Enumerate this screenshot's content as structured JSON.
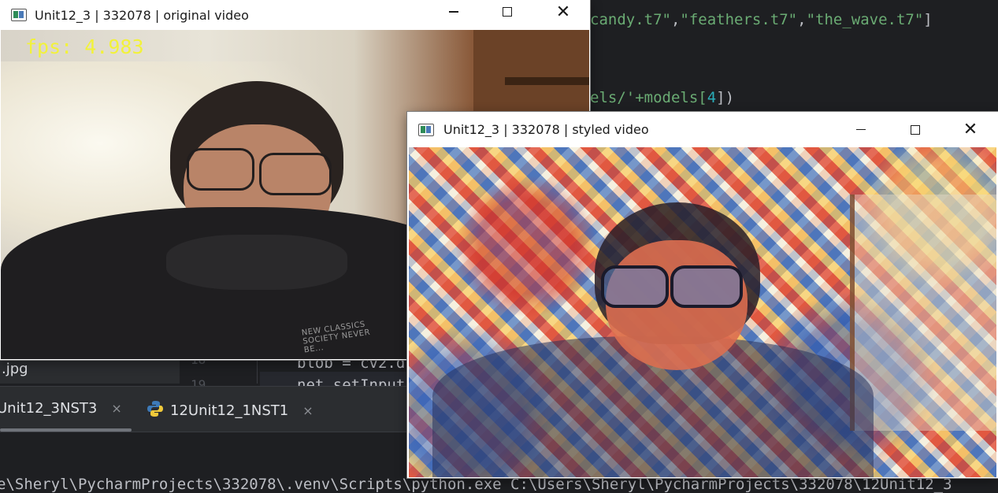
{
  "ide": {
    "code_line_1_a": "candy.t7\"",
    "code_line_1_b": ",",
    "code_line_1_c": "\"feathers.t7\"",
    "code_line_1_d": ",",
    "code_line_1_e": "\"the_wave.t7\"",
    "code_line_1_f": "]",
    "code_line_2_a": "els/'+models[",
    "code_line_2_b": "4",
    "code_line_2_c": "])",
    "code_line_3": "blob = cv2.d",
    "code_line_4": "net.setInput",
    "gutter_line_1": "18",
    "gutter_line_2": "19",
    "project_file": ".jpg",
    "run_tabs": [
      {
        "label": "Unit12_3NST3",
        "close": "×"
      },
      {
        "label": "12Unit12_1NST1",
        "close": "×"
      }
    ],
    "console_line": "e\\Sheryl\\PycharmProjects\\332078\\.venv\\Scripts\\python.exe C:\\Users\\Sheryl\\PycharmProjects\\332078\\12Unit12_3"
  },
  "window_original": {
    "title": "Unit12_3 | 332078 | original video",
    "fps_text": "fps: 4.983",
    "hoodie_text": "NEW CLASSICS SOCIETY NEVER BE..."
  },
  "window_styled": {
    "title": "Unit12_3 | 332078 | styled video"
  },
  "window_controls": {
    "close": "✕"
  },
  "colors": {
    "fps_overlay": "#f2f23a",
    "ide_bg": "#1e1f22",
    "string": "#6aab73",
    "number": "#2aacb8"
  },
  "icons": [
    "opencv-window-icon",
    "minimize-icon",
    "maximize-icon",
    "close-icon",
    "python-file-icon"
  ]
}
